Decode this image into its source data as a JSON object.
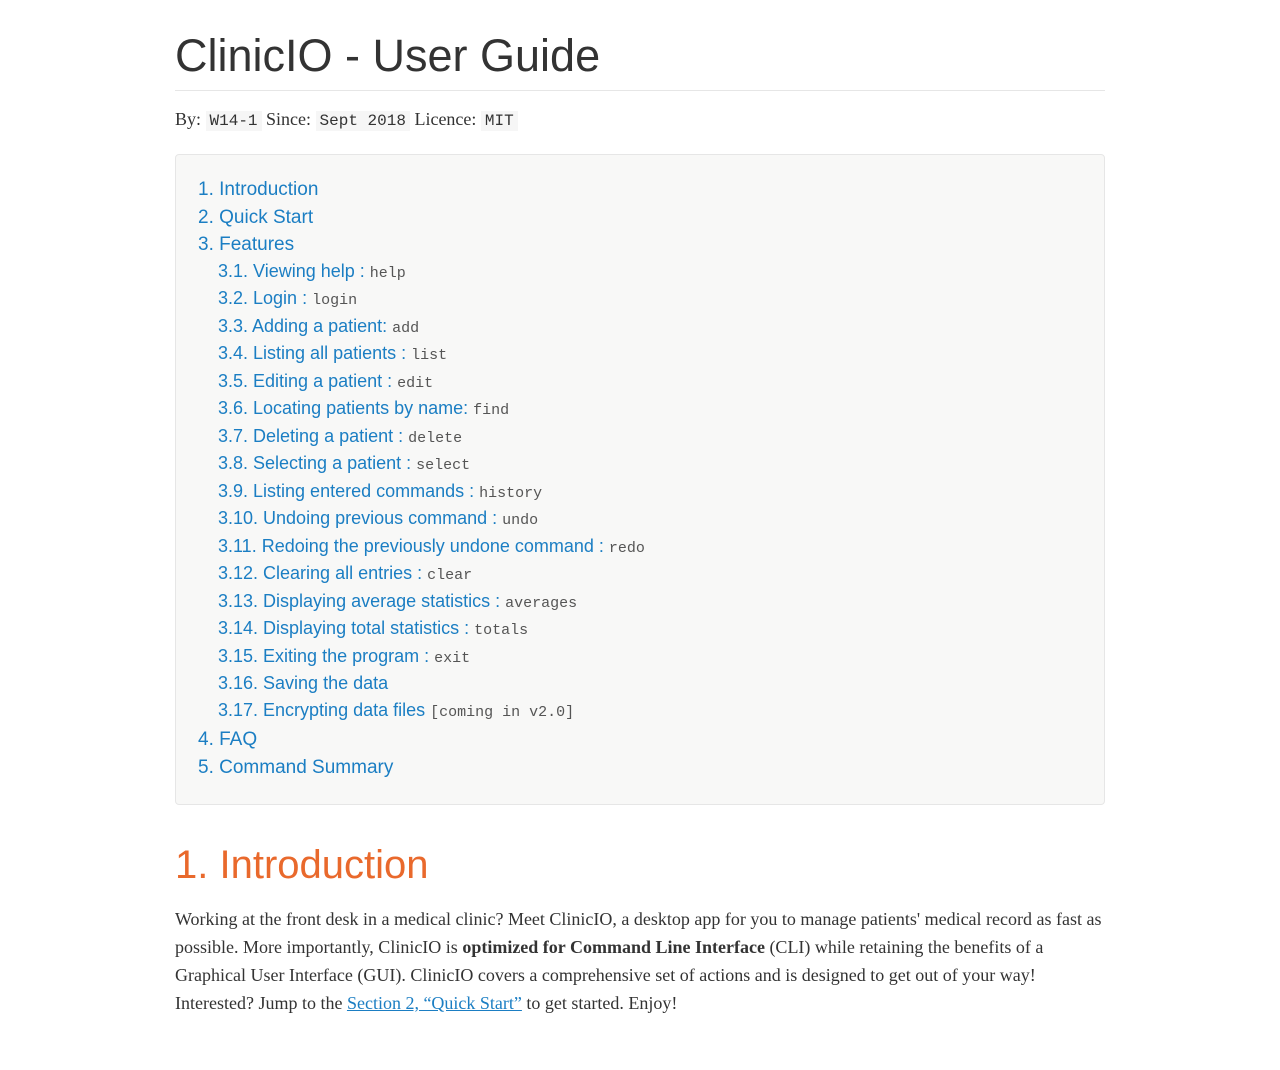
{
  "title": "ClinicIO - User Guide",
  "meta": {
    "by_label": "By: ",
    "by_value": "W14-1",
    "since_label": " Since: ",
    "since_value": "Sept 2018",
    "licence_label": " Licence: ",
    "licence_value": "MIT"
  },
  "toc": {
    "items": [
      {
        "label": "1. Introduction"
      },
      {
        "label": "2. Quick Start"
      },
      {
        "label": "3. Features",
        "children": [
          {
            "label": "3.1. Viewing help : ",
            "code": "help"
          },
          {
            "label": "3.2. Login : ",
            "code": "login"
          },
          {
            "label": "3.3. Adding a patient: ",
            "code": "add"
          },
          {
            "label": "3.4. Listing all patients : ",
            "code": "list"
          },
          {
            "label": "3.5. Editing a patient : ",
            "code": "edit"
          },
          {
            "label": "3.6. Locating patients by name: ",
            "code": "find"
          },
          {
            "label": "3.7. Deleting a patient : ",
            "code": "delete"
          },
          {
            "label": "3.8. Selecting a patient : ",
            "code": "select"
          },
          {
            "label": "3.9. Listing entered commands : ",
            "code": "history"
          },
          {
            "label": "3.10. Undoing previous command : ",
            "code": "undo"
          },
          {
            "label": "3.11. Redoing the previously undone command : ",
            "code": "redo"
          },
          {
            "label": "3.12. Clearing all entries : ",
            "code": "clear"
          },
          {
            "label": "3.13. Displaying average statistics : ",
            "code": "averages"
          },
          {
            "label": "3.14. Displaying total statistics : ",
            "code": "totals"
          },
          {
            "label": "3.15. Exiting the program : ",
            "code": "exit"
          },
          {
            "label": "3.16. Saving the data"
          },
          {
            "label": "3.17. Encrypting data files ",
            "code": "[coming in v2.0]"
          }
        ]
      },
      {
        "label": "4. FAQ"
      },
      {
        "label": "5. Command Summary"
      }
    ]
  },
  "section1": {
    "heading": "1. Introduction",
    "p1_a": "Working at the front desk in a medical clinic? Meet ClinicIO, a desktop app for you to manage patients' medical record as fast as possible. More importantly, ClinicIO is ",
    "p1_strong": "optimized for Command Line Interface",
    "p1_b": " (CLI) while retaining the benefits of a Graphical User Interface (GUI). ClinicIO covers a comprehensive set of actions and is designed to get out of your way! Interested? Jump to the ",
    "p1_link": "Section 2, “Quick Start”",
    "p1_c": " to get started. Enjoy!"
  }
}
